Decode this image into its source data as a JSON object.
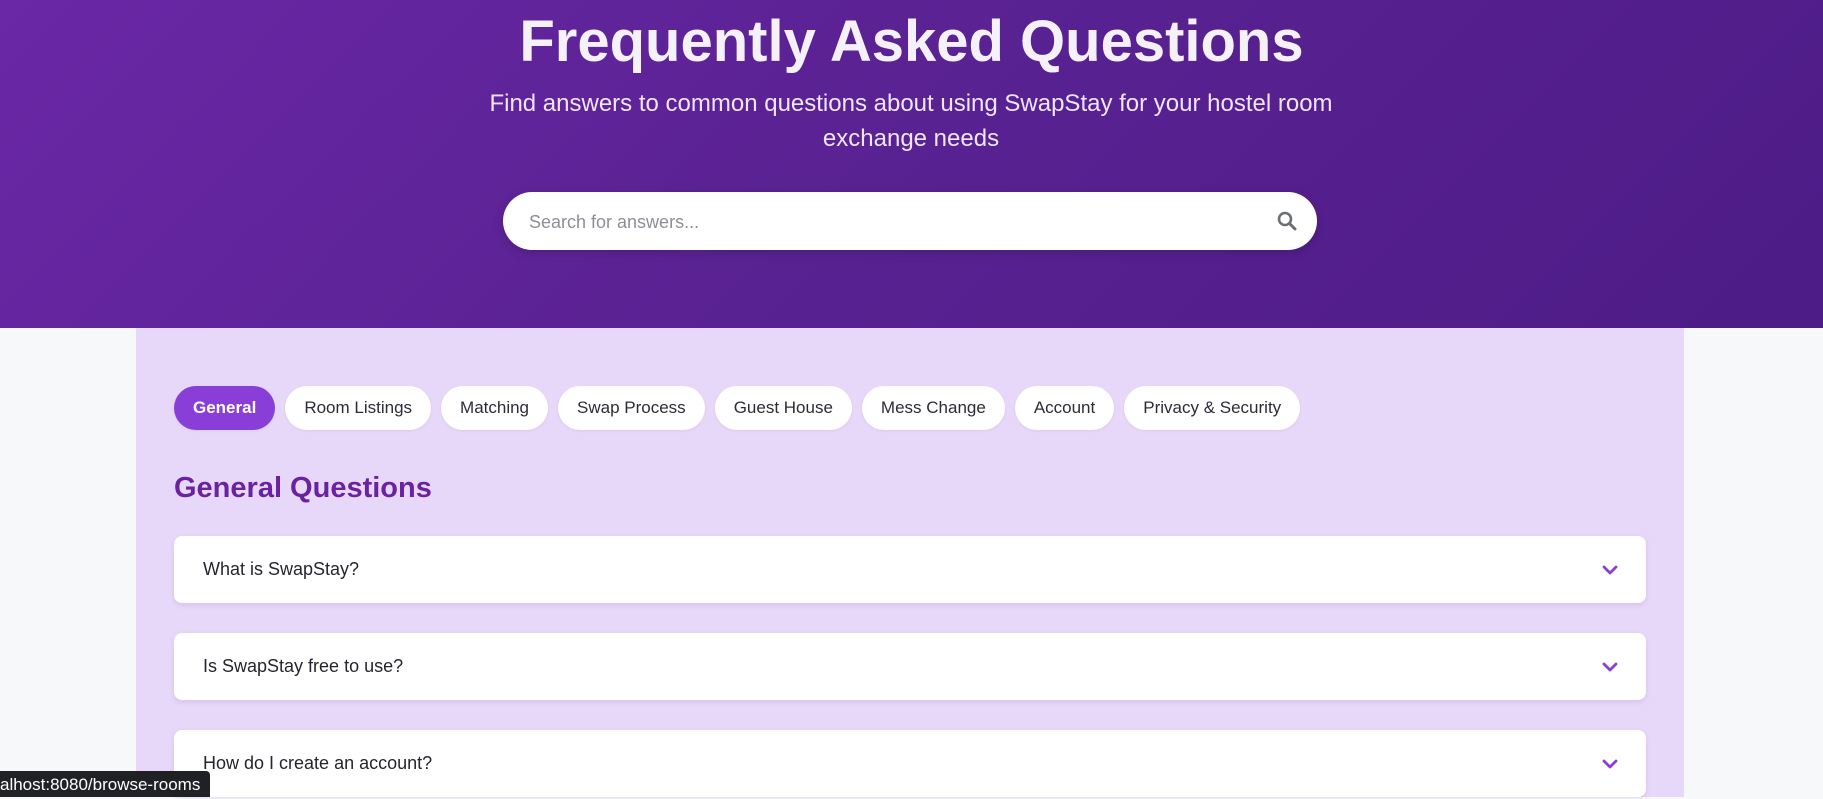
{
  "hero": {
    "title": "Frequently Asked Questions",
    "subtitle": "Find answers to common questions about using SwapStay for your hostel room exchange needs"
  },
  "search": {
    "placeholder": "Search for answers...",
    "value": "",
    "icon": "search-icon"
  },
  "tabs": [
    {
      "label": "General",
      "active": true
    },
    {
      "label": "Room Listings",
      "active": false
    },
    {
      "label": "Matching",
      "active": false
    },
    {
      "label": "Swap Process",
      "active": false
    },
    {
      "label": "Guest House",
      "active": false
    },
    {
      "label": "Mess Change",
      "active": false
    },
    {
      "label": "Account",
      "active": false
    },
    {
      "label": "Privacy & Security",
      "active": false
    }
  ],
  "section": {
    "title": "General Questions"
  },
  "faqs": [
    {
      "question": "What is SwapStay?",
      "icon": "chevron-down-icon"
    },
    {
      "question": "Is SwapStay free to use?",
      "icon": "chevron-down-icon"
    },
    {
      "question": "How do I create an account?",
      "icon": "chevron-down-icon"
    }
  ],
  "status_bar": {
    "url": "alhost:8080/browse-rooms"
  },
  "colors": {
    "hero_gradient_start": "#6a27a6",
    "hero_gradient_end": "#4d1c86",
    "panel_background": "#e7d8fa",
    "accent": "#8a3ed8",
    "section_title": "#6a22a0"
  }
}
